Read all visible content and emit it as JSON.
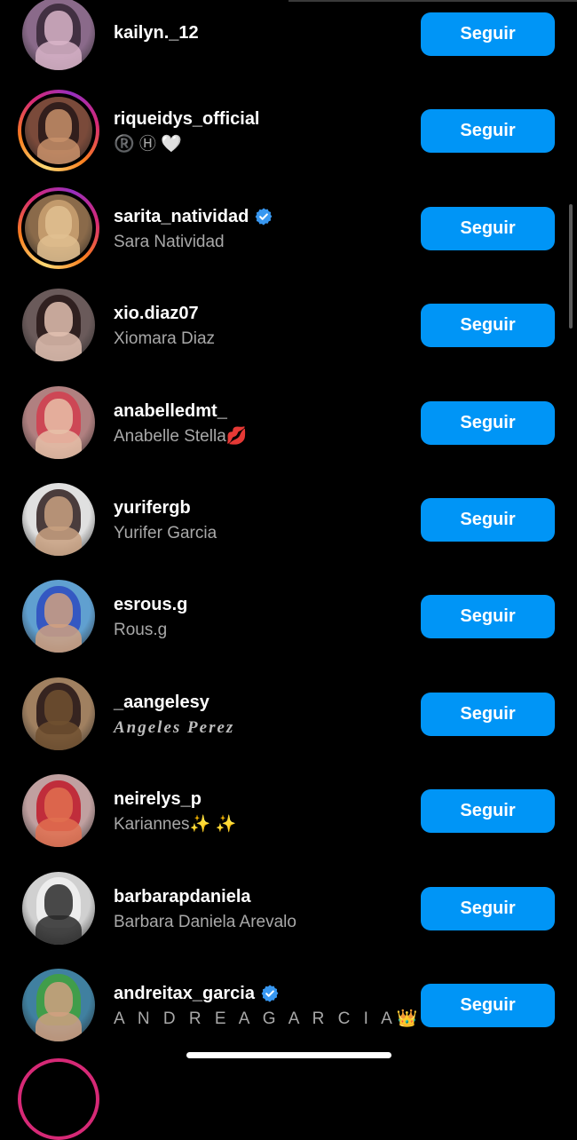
{
  "colors": {
    "background": "#000000",
    "follow_button": "#0095f6",
    "secondary_text": "#a8a8a8",
    "verified_badge": "#3897f0"
  },
  "follow_label": "Seguir",
  "accounts": [
    {
      "username": "kailyn._12",
      "fullname": "",
      "verified": false,
      "story_ring": false,
      "avatar_colors": [
        "#8a6a8a",
        "#d8b4c8",
        "#3a2a3a"
      ]
    },
    {
      "username": "riqueidys_official",
      "fullname": "®️ Ⓗ 🤍",
      "verified": false,
      "story_ring": true,
      "avatar_colors": [
        "#7a4a3a",
        "#c8906a",
        "#2a1a1a"
      ]
    },
    {
      "username": "sarita_natividad",
      "fullname": "Sara Natividad",
      "verified": true,
      "story_ring": true,
      "avatar_colors": [
        "#8a6a4a",
        "#e0c090",
        "#c8a070"
      ]
    },
    {
      "username": "xio.diaz07",
      "fullname": "Xiomara Diaz",
      "verified": false,
      "story_ring": false,
      "avatar_colors": [
        "#6a5a5a",
        "#e0c0b0",
        "#2a1a1a"
      ]
    },
    {
      "username": "anabelledmt_",
      "fullname": "Anabelle Stella💋",
      "verified": false,
      "story_ring": false,
      "avatar_colors": [
        "#b08080",
        "#e8c0a8",
        "#d04050"
      ]
    },
    {
      "username": "yurifergb",
      "fullname": "Yurifer Garcia",
      "verified": false,
      "story_ring": false,
      "avatar_colors": [
        "#e0e0e0",
        "#c8a080",
        "#3a2a2a"
      ]
    },
    {
      "username": "esrous.g",
      "fullname": "Rous.g",
      "verified": false,
      "story_ring": false,
      "avatar_colors": [
        "#60a0d0",
        "#d0a080",
        "#3050c0"
      ]
    },
    {
      "username": "_aangelesy",
      "fullname": "Angeles Perez",
      "verified": false,
      "story_ring": false,
      "avatar_colors": [
        "#a08060",
        "#705030",
        "#2a1a1a"
      ]
    },
    {
      "username": "neirelys_p",
      "fullname": "Kariannes✨ ✨",
      "verified": false,
      "story_ring": false,
      "avatar_colors": [
        "#c0a0a0",
        "#e07050",
        "#c02030"
      ]
    },
    {
      "username": "barbarapdaniela",
      "fullname": "Barbara Daniela Arevalo",
      "verified": false,
      "story_ring": false,
      "avatar_colors": [
        "#d0d0d0",
        "#2a2a2a",
        "#f0f0f0"
      ]
    },
    {
      "username": "andreitax_garcia",
      "fullname": "A N D R E A   G A R C I A👑",
      "verified": true,
      "story_ring": false,
      "avatar_colors": [
        "#4080a0",
        "#d0a080",
        "#40a040"
      ]
    }
  ]
}
